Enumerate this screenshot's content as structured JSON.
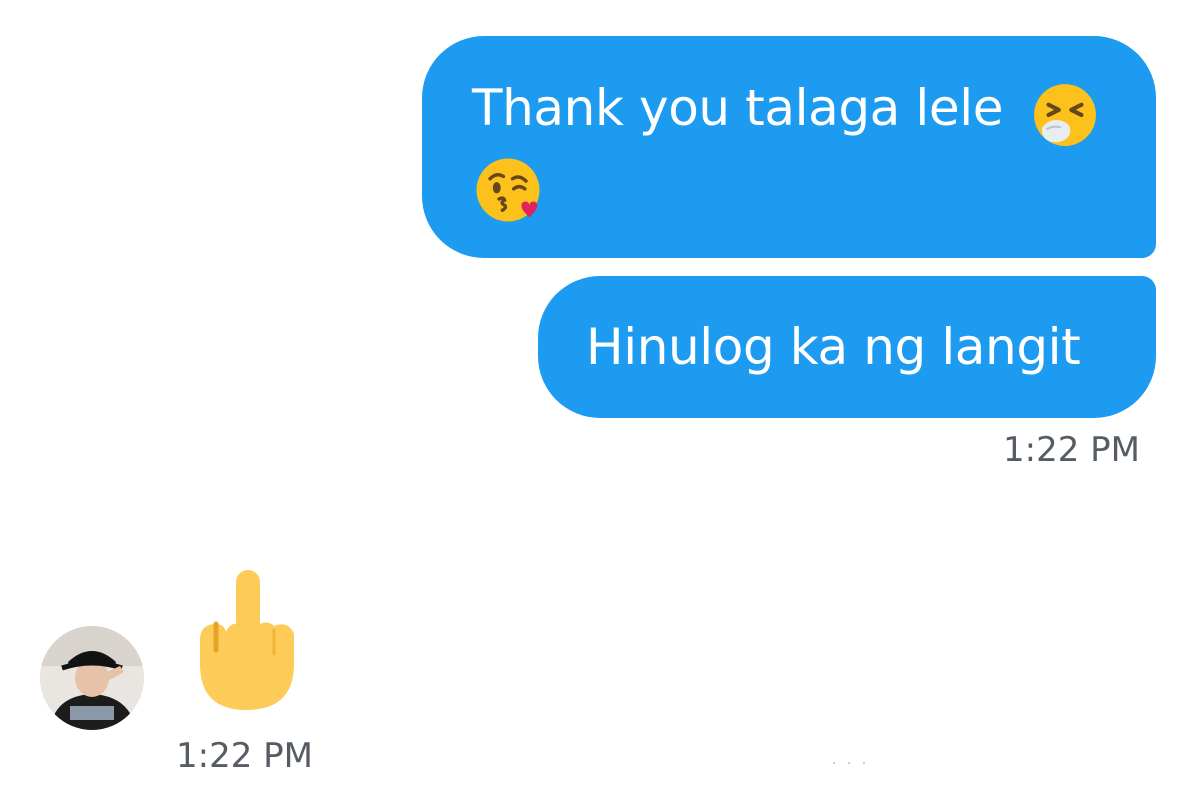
{
  "messages": {
    "sent": [
      {
        "line1": "Thank you talaga lele",
        "emoji_inline": "sneezing-face",
        "emoji_line2": "face-blowing-a-kiss"
      },
      {
        "text": "Hinulog ka ng langit"
      }
    ],
    "sent_time": "1:22 PM",
    "received": {
      "emoji": "middle-finger",
      "time": "1:22 PM"
    }
  },
  "colors": {
    "sent_bubble": "#1d9bf0",
    "sent_text": "#ffffff",
    "timestamp": "#555c63",
    "background": "#ffffff"
  }
}
